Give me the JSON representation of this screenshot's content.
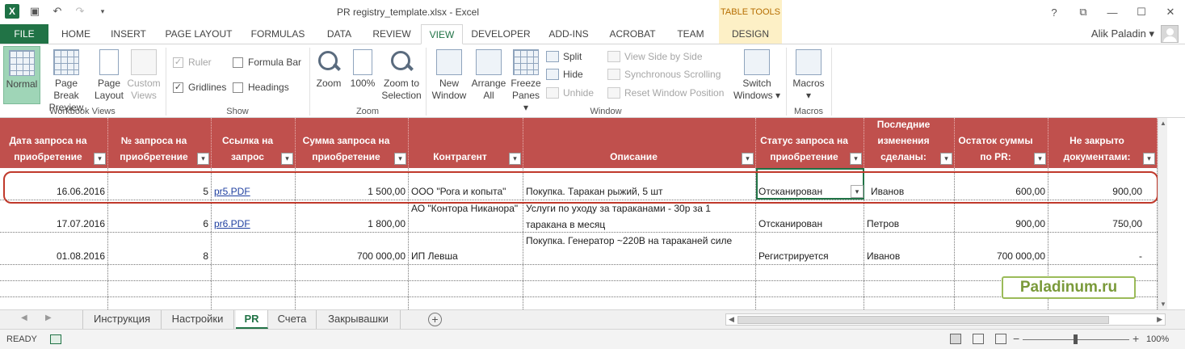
{
  "window": {
    "title": "PR registry_template.xlsx - Excel",
    "controls": [
      "?",
      "⧉",
      "—",
      "☐",
      "✕"
    ]
  },
  "qat": {
    "icons": [
      "excel-icon",
      "save-icon",
      "undo-icon",
      "redo-icon",
      "customize-icon"
    ]
  },
  "contextual": {
    "group": "TABLE TOOLS",
    "tab": "DESIGN"
  },
  "tabs": [
    "FILE",
    "HOME",
    "INSERT",
    "PAGE LAYOUT",
    "FORMULAS",
    "DATA",
    "REVIEW",
    "VIEW",
    "DEVELOPER",
    "ADD-INS",
    "ACROBAT",
    "TEAM"
  ],
  "user": {
    "name": "Alik Paladin ▾"
  },
  "ribbon": {
    "workbook_views": {
      "label": "Workbook Views",
      "normal": "Normal",
      "page_break_1": "Page Break",
      "page_break_2": "Preview",
      "page_layout_1": "Page",
      "page_layout_2": "Layout",
      "custom_1": "Custom",
      "custom_2": "Views"
    },
    "show": {
      "label": "Show",
      "ruler": "Ruler",
      "formula_bar": "Formula Bar",
      "gridlines": "Gridlines",
      "headings": "Headings"
    },
    "zoom": {
      "label": "Zoom",
      "zoom": "Zoom",
      "hundred": "100%",
      "zts_1": "Zoom to",
      "zts_2": "Selection"
    },
    "window": {
      "label": "Window",
      "new_1": "New",
      "new_2": "Window",
      "arrange_1": "Arrange",
      "arrange_2": "All",
      "freeze_1": "Freeze",
      "freeze_2": "Panes ▾",
      "split": "Split",
      "hide": "Hide",
      "unhide": "Unhide",
      "side_by_side": "View Side by Side",
      "sync_scroll": "Synchronous Scrolling",
      "reset_pos": "Reset Window Position",
      "switch_1": "Switch",
      "switch_2": "Windows ▾"
    },
    "macros": {
      "label": "Macros",
      "btn_1": "Macros",
      "btn_2": "▾"
    }
  },
  "table": {
    "headers": [
      "Дата запроса на приобретение",
      "№ запроса на приобретение",
      "Ссылка на запрос",
      "Сумма запроса на приобретение",
      "Контрагент",
      "Описание",
      "Статус запроса на приобретение",
      "Последние изменения сделаны:",
      "Остаток суммы по PR:",
      "Не закрыто документами:"
    ],
    "rows": [
      [
        "16.06.2016",
        "5",
        "pr5.PDF",
        "1 500,00",
        "ООО \"Рога и копыта\"",
        "Покупка. Таракан рыжий, 5 шт",
        "Отсканирован",
        "Иванов",
        "600,00",
        "900,00"
      ],
      [
        "17.07.2016",
        "6",
        "pr6.PDF",
        "1 800,00",
        "АО \"Контора Никанора\"",
        "Услуги по уходу за тараканами - 30р за 1 таракана в месяц",
        "Отсканирован",
        "Петров",
        "900,00",
        "750,00"
      ],
      [
        "01.08.2016",
        "8",
        "",
        "700 000,00",
        "ИП Левша",
        "Покупка. Генератор ~220В на тараканей силе",
        "Регистрируется",
        "Иванов",
        "700 000,00",
        "-"
      ]
    ]
  },
  "watermark": "Paladinum.ru",
  "sheets": [
    "Инструкция",
    "Настройки",
    "PR",
    "Счета",
    "Закрывашки"
  ],
  "active_sheet": "PR",
  "status": {
    "ready": "READY",
    "zoom": "100%",
    "minus": "−",
    "plus": "+"
  }
}
